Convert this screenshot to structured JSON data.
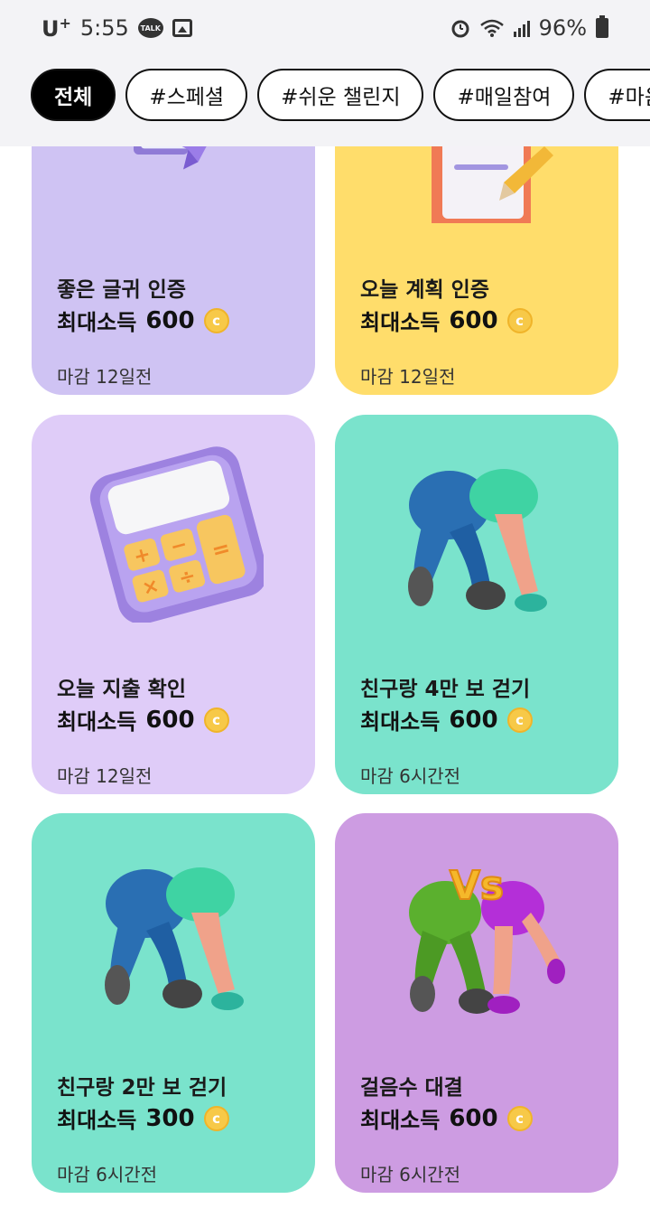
{
  "status_bar": {
    "carrier": "U",
    "carrier_sup": "+",
    "time": "5:55",
    "talk_label": "TALK",
    "battery": "96%"
  },
  "filters": {
    "chips": [
      "전체",
      "#스페셜",
      "#쉬운 챌린지",
      "#매일참여",
      "#마음 실"
    ]
  },
  "reward_label": "최대소득",
  "coin_symbol": "c",
  "cards": [
    {
      "title": "좋은 글귀 인증",
      "reward": "600",
      "deadline": "마감 12일전",
      "bg": "#cfc3f3",
      "art": "letter-paper-plane"
    },
    {
      "title": "오늘 계획 인증",
      "reward": "600",
      "deadline": "마감 12일전",
      "bg": "#ffdd6b",
      "art": "clipboard-pencil"
    },
    {
      "title": "오늘 지출 확인",
      "reward": "600",
      "deadline": "마감 12일전",
      "bg": "#dfccf8",
      "art": "calculator"
    },
    {
      "title": "친구랑 4만 보 걷기",
      "reward": "600",
      "deadline": "마감 6시간전",
      "bg": "#7ae3cc",
      "art": "walking-legs"
    },
    {
      "title": "친구랑 2만 보 걷기",
      "reward": "300",
      "deadline": "마감 6시간전",
      "bg": "#7ae3cc",
      "art": "walking-legs"
    },
    {
      "title": "걸음수 대결",
      "reward": "600",
      "deadline": "마감 6시간전",
      "bg": "#cd9ce2",
      "art": "versus-legs"
    }
  ]
}
